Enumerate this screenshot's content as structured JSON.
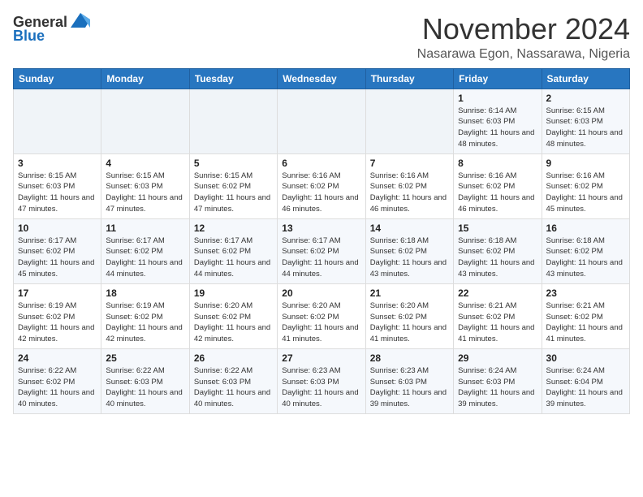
{
  "header": {
    "logo_general": "General",
    "logo_blue": "Blue",
    "month": "November 2024",
    "location": "Nasarawa Egon, Nassarawa, Nigeria"
  },
  "days_of_week": [
    "Sunday",
    "Monday",
    "Tuesday",
    "Wednesday",
    "Thursday",
    "Friday",
    "Saturday"
  ],
  "weeks": [
    [
      {
        "day": "",
        "info": ""
      },
      {
        "day": "",
        "info": ""
      },
      {
        "day": "",
        "info": ""
      },
      {
        "day": "",
        "info": ""
      },
      {
        "day": "",
        "info": ""
      },
      {
        "day": "1",
        "info": "Sunrise: 6:14 AM\nSunset: 6:03 PM\nDaylight: 11 hours and 48 minutes."
      },
      {
        "day": "2",
        "info": "Sunrise: 6:15 AM\nSunset: 6:03 PM\nDaylight: 11 hours and 48 minutes."
      }
    ],
    [
      {
        "day": "3",
        "info": "Sunrise: 6:15 AM\nSunset: 6:03 PM\nDaylight: 11 hours and 47 minutes."
      },
      {
        "day": "4",
        "info": "Sunrise: 6:15 AM\nSunset: 6:03 PM\nDaylight: 11 hours and 47 minutes."
      },
      {
        "day": "5",
        "info": "Sunrise: 6:15 AM\nSunset: 6:02 PM\nDaylight: 11 hours and 47 minutes."
      },
      {
        "day": "6",
        "info": "Sunrise: 6:16 AM\nSunset: 6:02 PM\nDaylight: 11 hours and 46 minutes."
      },
      {
        "day": "7",
        "info": "Sunrise: 6:16 AM\nSunset: 6:02 PM\nDaylight: 11 hours and 46 minutes."
      },
      {
        "day": "8",
        "info": "Sunrise: 6:16 AM\nSunset: 6:02 PM\nDaylight: 11 hours and 46 minutes."
      },
      {
        "day": "9",
        "info": "Sunrise: 6:16 AM\nSunset: 6:02 PM\nDaylight: 11 hours and 45 minutes."
      }
    ],
    [
      {
        "day": "10",
        "info": "Sunrise: 6:17 AM\nSunset: 6:02 PM\nDaylight: 11 hours and 45 minutes."
      },
      {
        "day": "11",
        "info": "Sunrise: 6:17 AM\nSunset: 6:02 PM\nDaylight: 11 hours and 44 minutes."
      },
      {
        "day": "12",
        "info": "Sunrise: 6:17 AM\nSunset: 6:02 PM\nDaylight: 11 hours and 44 minutes."
      },
      {
        "day": "13",
        "info": "Sunrise: 6:17 AM\nSunset: 6:02 PM\nDaylight: 11 hours and 44 minutes."
      },
      {
        "day": "14",
        "info": "Sunrise: 6:18 AM\nSunset: 6:02 PM\nDaylight: 11 hours and 43 minutes."
      },
      {
        "day": "15",
        "info": "Sunrise: 6:18 AM\nSunset: 6:02 PM\nDaylight: 11 hours and 43 minutes."
      },
      {
        "day": "16",
        "info": "Sunrise: 6:18 AM\nSunset: 6:02 PM\nDaylight: 11 hours and 43 minutes."
      }
    ],
    [
      {
        "day": "17",
        "info": "Sunrise: 6:19 AM\nSunset: 6:02 PM\nDaylight: 11 hours and 42 minutes."
      },
      {
        "day": "18",
        "info": "Sunrise: 6:19 AM\nSunset: 6:02 PM\nDaylight: 11 hours and 42 minutes."
      },
      {
        "day": "19",
        "info": "Sunrise: 6:20 AM\nSunset: 6:02 PM\nDaylight: 11 hours and 42 minutes."
      },
      {
        "day": "20",
        "info": "Sunrise: 6:20 AM\nSunset: 6:02 PM\nDaylight: 11 hours and 41 minutes."
      },
      {
        "day": "21",
        "info": "Sunrise: 6:20 AM\nSunset: 6:02 PM\nDaylight: 11 hours and 41 minutes."
      },
      {
        "day": "22",
        "info": "Sunrise: 6:21 AM\nSunset: 6:02 PM\nDaylight: 11 hours and 41 minutes."
      },
      {
        "day": "23",
        "info": "Sunrise: 6:21 AM\nSunset: 6:02 PM\nDaylight: 11 hours and 41 minutes."
      }
    ],
    [
      {
        "day": "24",
        "info": "Sunrise: 6:22 AM\nSunset: 6:02 PM\nDaylight: 11 hours and 40 minutes."
      },
      {
        "day": "25",
        "info": "Sunrise: 6:22 AM\nSunset: 6:03 PM\nDaylight: 11 hours and 40 minutes."
      },
      {
        "day": "26",
        "info": "Sunrise: 6:22 AM\nSunset: 6:03 PM\nDaylight: 11 hours and 40 minutes."
      },
      {
        "day": "27",
        "info": "Sunrise: 6:23 AM\nSunset: 6:03 PM\nDaylight: 11 hours and 40 minutes."
      },
      {
        "day": "28",
        "info": "Sunrise: 6:23 AM\nSunset: 6:03 PM\nDaylight: 11 hours and 39 minutes."
      },
      {
        "day": "29",
        "info": "Sunrise: 6:24 AM\nSunset: 6:03 PM\nDaylight: 11 hours and 39 minutes."
      },
      {
        "day": "30",
        "info": "Sunrise: 6:24 AM\nSunset: 6:04 PM\nDaylight: 11 hours and 39 minutes."
      }
    ]
  ]
}
